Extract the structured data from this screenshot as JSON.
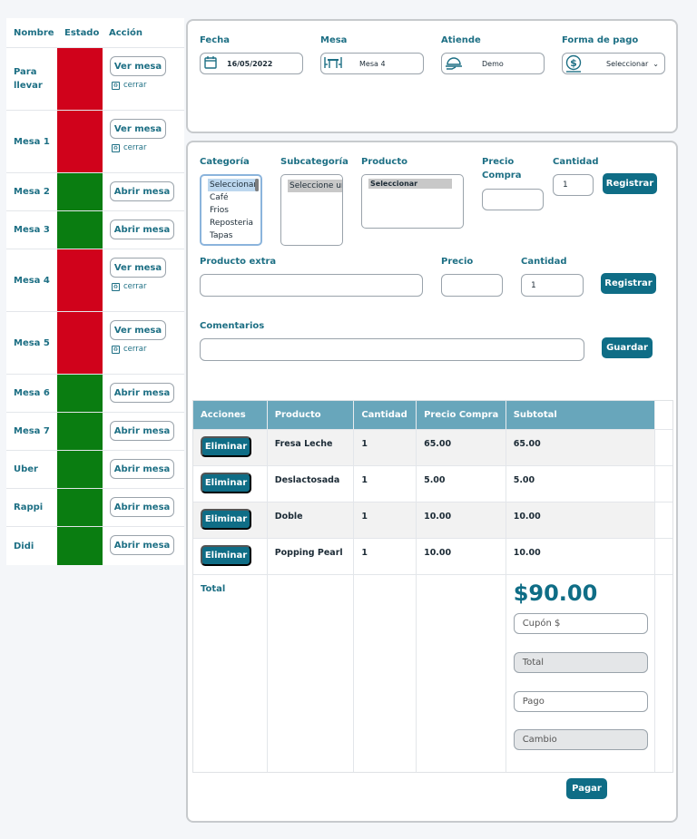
{
  "tables": {
    "headers": {
      "nombre": "Nombre",
      "estado": "Estado",
      "accion": "Acción"
    },
    "rows": [
      {
        "name": "Para llevar",
        "action": "Ver mesa",
        "close": "cerrar"
      },
      {
        "name": "Mesa 1",
        "action": "Ver mesa",
        "close": "cerrar"
      },
      {
        "name": "Mesa 2",
        "action": "Abrir mesa"
      },
      {
        "name": "Mesa 3",
        "action": "Abrir mesa"
      },
      {
        "name": "Mesa 4",
        "action": "Ver mesa",
        "close": "cerrar"
      },
      {
        "name": "Mesa 5",
        "action": "Ver mesa",
        "close": "cerrar"
      },
      {
        "name": "Mesa 6",
        "action": "Abrir mesa"
      },
      {
        "name": "Mesa 7",
        "action": "Abrir mesa"
      },
      {
        "name": "Uber",
        "action": "Abrir mesa"
      },
      {
        "name": "Rappi",
        "action": "Abrir mesa"
      },
      {
        "name": "Didi",
        "action": "Abrir mesa"
      }
    ],
    "status_colors": {
      "occupied": "#d0021b",
      "free": "#0a7d11"
    }
  },
  "order": {
    "fecha_label": "Fecha",
    "fecha_value": "16/05/2022",
    "mesa_label": "Mesa",
    "mesa_value": "Mesa 4",
    "atiende_label": "Atiende",
    "atiende_value": "Demo",
    "pago_label": "Forma de pago",
    "pago_value": "Seleccionar"
  },
  "entry": {
    "categoria_label": "Categoría",
    "categoria_options": [
      "Seleccionar",
      "Café",
      "Frios",
      "Reposteria",
      "Tapas"
    ],
    "subcategoria_label": "Subcategoría",
    "subcategoria_value": "Seleccione ur",
    "producto_label": "Producto",
    "producto_value": "Seleccionar",
    "precio_compra_label_1": "Precio",
    "precio_compra_label_2": "Compra",
    "cantidad_label": "Cantidad",
    "cantidad_value": "1",
    "registrar_label": "Registrar",
    "extra_label": "Producto extra",
    "precio_label": "Precio",
    "cantidad2_label": "Cantidad",
    "cantidad2_value": "1",
    "registrar2_label": "Registrar",
    "comentarios_label": "Comentarios",
    "guardar_label": "Guardar"
  },
  "items": {
    "headers": [
      "Acciones",
      "Producto",
      "Cantidad",
      "Precio Compra",
      "Subtotal"
    ],
    "rows": [
      {
        "action": "Eliminar",
        "producto": "Fresa Leche",
        "cantidad": "1",
        "precio": "65.00",
        "subtotal": "65.00"
      },
      {
        "action": "Eliminar",
        "producto": "Deslactosada",
        "cantidad": "1",
        "precio": "5.00",
        "subtotal": "5.00"
      },
      {
        "action": "Eliminar",
        "producto": "Doble",
        "cantidad": "1",
        "precio": "10.00",
        "subtotal": "10.00"
      },
      {
        "action": "Eliminar",
        "producto": "Popping Pearl",
        "cantidad": "1",
        "precio": "10.00",
        "subtotal": "10.00"
      }
    ],
    "total_label": "Total",
    "total_value": "$90.00",
    "cupon_placeholder": "Cupón $",
    "total_placeholder": "Total",
    "pago_placeholder": "Pago",
    "cambio_placeholder": "Cambio",
    "pagar_label": "Pagar"
  }
}
